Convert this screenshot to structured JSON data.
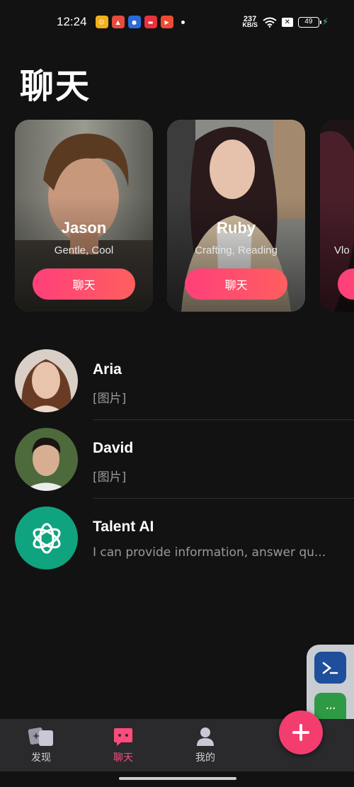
{
  "status_bar": {
    "time": "12:24",
    "speed_value": "237",
    "speed_unit": "KB/S",
    "battery": "49"
  },
  "header": {
    "title": "聊天"
  },
  "cards": [
    {
      "name": "Jason",
      "tags": "Gentle, Cool",
      "button": "聊天"
    },
    {
      "name": "Ruby",
      "tags": "Crafting, Reading",
      "button": "聊天"
    },
    {
      "name": "",
      "tags": "Vlo",
      "button": ""
    }
  ],
  "chats": [
    {
      "name": "Aria",
      "preview": "[图片]"
    },
    {
      "name": "David",
      "preview": "[图片]"
    },
    {
      "name": "Talent AI",
      "preview": "I can provide information, answer qu..."
    }
  ],
  "bottom_nav": {
    "items": [
      {
        "label": "发现",
        "icon": "discover-icon"
      },
      {
        "label": "聊天",
        "icon": "chat-icon"
      },
      {
        "label": "我的",
        "icon": "profile-icon"
      }
    ],
    "active_index": 1,
    "fab_icon": "plus-icon"
  },
  "colors": {
    "background": "#121212",
    "accent": "#ff4b7c",
    "nav_background": "#2a2a2d"
  }
}
